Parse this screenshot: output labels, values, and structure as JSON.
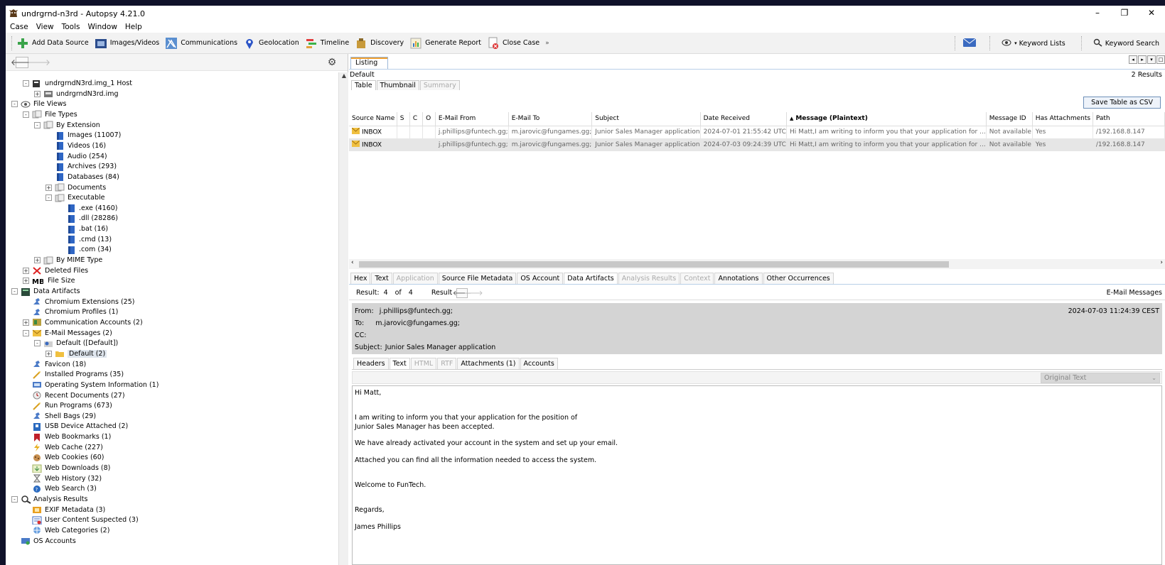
{
  "window": {
    "title": "undrgrnd-n3rd - Autopsy 4.21.0"
  },
  "menu": [
    "Case",
    "View",
    "Tools",
    "Window",
    "Help"
  ],
  "toolbar": {
    "items": [
      "Add Data Source",
      "Images/Videos",
      "Communications",
      "Geolocation",
      "Timeline",
      "Discovery",
      "Generate Report",
      "Close Case"
    ],
    "keyword_lists": "Keyword Lists",
    "keyword_search": "Keyword Search"
  },
  "tree": [
    {
      "label": "undrgrndN3rd.img_1 Host",
      "depth": 1,
      "exp": "-",
      "icon": "host"
    },
    {
      "label": "undrgrndN3rd.img",
      "depth": 2,
      "exp": "+",
      "icon": "disk"
    },
    {
      "label": "File Views",
      "depth": 0,
      "exp": "-",
      "icon": "eye"
    },
    {
      "label": "File Types",
      "depth": 1,
      "exp": "-",
      "icon": "filetypes"
    },
    {
      "label": "By Extension",
      "depth": 2,
      "exp": "-",
      "icon": "filetypes"
    },
    {
      "label": "Images (11007)",
      "depth": 3,
      "exp": "",
      "icon": "blue"
    },
    {
      "label": "Videos (16)",
      "depth": 3,
      "exp": "",
      "icon": "blue"
    },
    {
      "label": "Audio (254)",
      "depth": 3,
      "exp": "",
      "icon": "blue"
    },
    {
      "label": "Archives (293)",
      "depth": 3,
      "exp": "",
      "icon": "blue"
    },
    {
      "label": "Databases (84)",
      "depth": 3,
      "exp": "",
      "icon": "blue"
    },
    {
      "label": "Documents",
      "depth": 3,
      "exp": "+",
      "icon": "filetypes"
    },
    {
      "label": "Executable",
      "depth": 3,
      "exp": "-",
      "icon": "filetypes"
    },
    {
      "label": ".exe (4160)",
      "depth": 4,
      "exp": "",
      "icon": "blue"
    },
    {
      "label": ".dll (28286)",
      "depth": 4,
      "exp": "",
      "icon": "blue"
    },
    {
      "label": ".bat (16)",
      "depth": 4,
      "exp": "",
      "icon": "blue"
    },
    {
      "label": ".cmd (13)",
      "depth": 4,
      "exp": "",
      "icon": "blue"
    },
    {
      "label": ".com (34)",
      "depth": 4,
      "exp": "",
      "icon": "blue"
    },
    {
      "label": "By MIME Type",
      "depth": 2,
      "exp": "+",
      "icon": "filetypes"
    },
    {
      "label": "Deleted Files",
      "depth": 1,
      "exp": "+",
      "icon": "deleted"
    },
    {
      "label": "File Size",
      "depth": 1,
      "exp": "+",
      "icon": "mb"
    },
    {
      "label": "Data Artifacts",
      "depth": 0,
      "exp": "-",
      "icon": "artifacts"
    },
    {
      "label": "Chromium Extensions (25)",
      "depth": 1,
      "exp": "",
      "icon": "puzzle"
    },
    {
      "label": "Chromium Profiles (1)",
      "depth": 1,
      "exp": "",
      "icon": "puzzle"
    },
    {
      "label": "Communication Accounts (2)",
      "depth": 1,
      "exp": "+",
      "icon": "accounts"
    },
    {
      "label": "E-Mail Messages (2)",
      "depth": 1,
      "exp": "-",
      "icon": "mail"
    },
    {
      "label": "Default ([Default])",
      "depth": 2,
      "exp": "-",
      "icon": "mailacct"
    },
    {
      "label": "Default (2)",
      "depth": 3,
      "exp": "+",
      "icon": "folder",
      "selected": true
    },
    {
      "label": "Favicon (18)",
      "depth": 1,
      "exp": "",
      "icon": "puzzle"
    },
    {
      "label": "Installed Programs (35)",
      "depth": 1,
      "exp": "",
      "icon": "wand"
    },
    {
      "label": "Operating System Information (1)",
      "depth": 1,
      "exp": "",
      "icon": "os"
    },
    {
      "label": "Recent Documents (27)",
      "depth": 1,
      "exp": "",
      "icon": "recent"
    },
    {
      "label": "Run Programs (673)",
      "depth": 1,
      "exp": "",
      "icon": "wand"
    },
    {
      "label": "Shell Bags (29)",
      "depth": 1,
      "exp": "",
      "icon": "puzzle"
    },
    {
      "label": "USB Device Attached (2)",
      "depth": 1,
      "exp": "",
      "icon": "usb"
    },
    {
      "label": "Web Bookmarks (1)",
      "depth": 1,
      "exp": "",
      "icon": "bookmark"
    },
    {
      "label": "Web Cache (227)",
      "depth": 1,
      "exp": "",
      "icon": "bolt"
    },
    {
      "label": "Web Cookies (60)",
      "depth": 1,
      "exp": "",
      "icon": "cookie"
    },
    {
      "label": "Web Downloads (8)",
      "depth": 1,
      "exp": "",
      "icon": "download"
    },
    {
      "label": "Web History (32)",
      "depth": 1,
      "exp": "",
      "icon": "hourglass"
    },
    {
      "label": "Web Search (3)",
      "depth": 1,
      "exp": "",
      "icon": "search"
    },
    {
      "label": "Analysis Results",
      "depth": 0,
      "exp": "-",
      "icon": "magnifier"
    },
    {
      "label": "EXIF Metadata (3)",
      "depth": 1,
      "exp": "",
      "icon": "exif"
    },
    {
      "label": "User Content Suspected (3)",
      "depth": 1,
      "exp": "",
      "icon": "usercontent"
    },
    {
      "label": "Web Categories (2)",
      "depth": 1,
      "exp": "",
      "icon": "globe"
    },
    {
      "label": "OS Accounts",
      "depth": 0,
      "exp": "",
      "icon": "osacct"
    }
  ],
  "listing": {
    "tab": "Listing",
    "default_label": "Default",
    "results_count": "2 Results",
    "views": [
      "Table",
      "Thumbnail",
      "Summary"
    ],
    "save_csv": "Save Table as CSV",
    "columns": [
      "Source Name",
      "S",
      "C",
      "O",
      "E-Mail From",
      "E-Mail To",
      "Subject",
      "Date Received",
      "Message (Plaintext)",
      "Message ID",
      "Has Attachments",
      "Path"
    ],
    "sort_indicator": "▲",
    "rows": [
      [
        "INBOX",
        "",
        "",
        "",
        "j.phillips@funtech.gg;",
        "m.jarovic@fungames.gg;",
        "Junior Sales Manager application",
        "2024-07-01 21:55:42 UTC",
        "Hi Matt,I am writing to inform you that your application for ...",
        "Not available",
        "Yes",
        "/192.168.8.147"
      ],
      [
        "INBOX",
        "",
        "",
        "",
        "j.phillips@funtech.gg;",
        "m.jarovic@fungames.gg;",
        "Junior Sales Manager application",
        "2024-07-03 09:24:39 UTC",
        "Hi Matt,I am writing to inform you that your application for ...",
        "Not available",
        "Yes",
        "/192.168.8.147"
      ]
    ]
  },
  "viewer_tabs": [
    "Hex",
    "Text",
    "Application",
    "Source File Metadata",
    "OS Account",
    "Data Artifacts",
    "Analysis Results",
    "Context",
    "Annotations",
    "Other Occurrences"
  ],
  "result_bar": {
    "result_label": "Result:",
    "current": "4",
    "of": "of",
    "total": "4",
    "result_word": "Result",
    "type": "E-Mail Messages"
  },
  "email": {
    "from_label": "From:",
    "from": "j.phillips@funtech.gg;",
    "to_label": "To:",
    "to": "m.jarovic@fungames.gg;",
    "cc_label": "CC:",
    "subject_label": "Subject:",
    "subject": "Junior Sales Manager application",
    "date": "2024-07-03 11:24:39 CEST",
    "tabs": [
      "Headers",
      "Text",
      "HTML",
      "RTF",
      "Attachments (1)",
      "Accounts"
    ],
    "format": "Original Text",
    "body": [
      "Hi Matt,",
      "",
      "",
      "I am writing to inform you that your application for the position of",
      "Junior Sales Manager has been accepted.",
      "",
      "We have already activated your account in the system and set up your email.",
      "",
      "Attached you can find all the information needed to access the system.",
      "",
      "",
      "Welcome to FunTech.",
      "",
      "",
      "Regards,",
      "",
      "James Phillips"
    ]
  }
}
